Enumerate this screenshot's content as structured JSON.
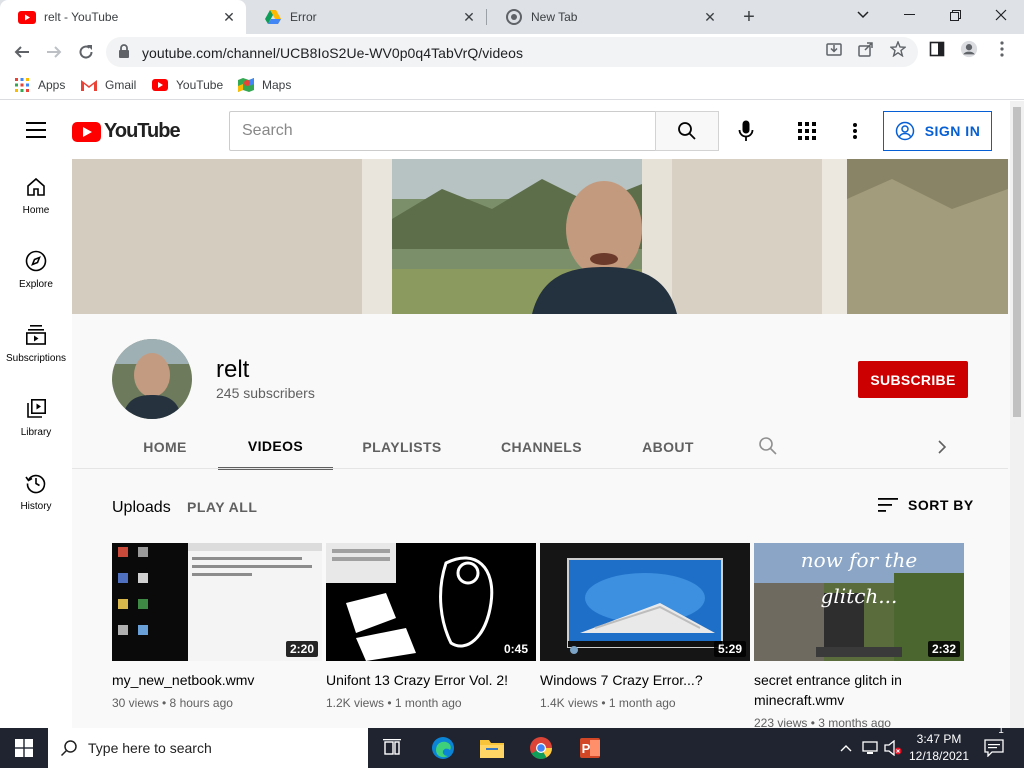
{
  "browser": {
    "tabs": [
      {
        "title": "relt - YouTube"
      },
      {
        "title": "Error"
      },
      {
        "title": "New Tab"
      }
    ],
    "url": "youtube.com/channel/UCB8IoS2Ue-WV0p0q4TabVrQ/videos",
    "bookmarks": [
      {
        "label": "Apps",
        "icon": "apps-grid-icon"
      },
      {
        "label": "Gmail",
        "icon": "gmail-icon"
      },
      {
        "label": "YouTube",
        "icon": "youtube-icon"
      },
      {
        "label": "Maps",
        "icon": "maps-icon"
      }
    ]
  },
  "youtube": {
    "logo_text": "YouTube",
    "search_placeholder": "Search",
    "sign_in": "SIGN IN",
    "sidebar": [
      {
        "label": "Home",
        "icon": "home-icon"
      },
      {
        "label": "Explore",
        "icon": "compass-icon"
      },
      {
        "label": "Subscriptions",
        "icon": "subscriptions-icon"
      },
      {
        "label": "Library",
        "icon": "library-icon"
      },
      {
        "label": "History",
        "icon": "history-icon"
      }
    ],
    "channel": {
      "name": "relt",
      "subscribers": "245 subscribers",
      "subscribe_label": "SUBSCRIBE"
    },
    "channel_tabs": [
      "HOME",
      "VIDEOS",
      "PLAYLISTS",
      "CHANNELS",
      "ABOUT"
    ],
    "selected_tab": "VIDEOS",
    "uploads": {
      "title": "Uploads",
      "play_all": "PLAY ALL",
      "sort_by": "SORT BY"
    },
    "videos": [
      {
        "title": "my_new_netbook.wmv",
        "duration": "2:20",
        "meta": "30 views • 8 hours ago"
      },
      {
        "title": "Unifont 13 Crazy Error Vol. 2!",
        "duration": "0:45",
        "meta": "1.2K views • 1 month ago"
      },
      {
        "title": "Windows 7 Crazy Error...?",
        "duration": "5:29",
        "meta": "1.4K views • 1 month ago"
      },
      {
        "title": "secret entrance glitch in minecraft.wmv",
        "duration": "2:32",
        "meta": "223 views • 3 months ago",
        "thumb_text": "now for the glitch..."
      }
    ]
  },
  "taskbar": {
    "search_placeholder": "Type here to search",
    "time": "3:47 PM",
    "date": "12/18/2021",
    "notification_count": "1"
  }
}
